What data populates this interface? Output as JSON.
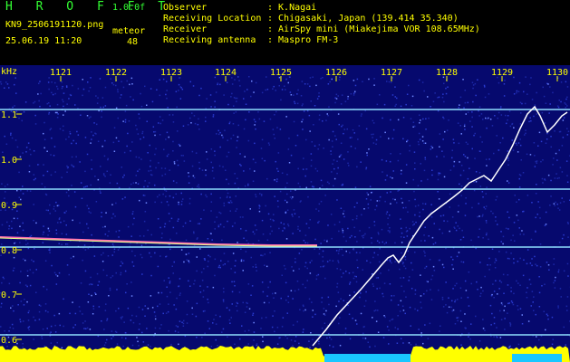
{
  "app": {
    "brand": "H R O F F T",
    "version": "1.0.0f"
  },
  "file": {
    "name": "KN9_2506191120.png",
    "timestamp": "25.06.19 11:20"
  },
  "meteor": {
    "label": "meteor",
    "count": "48"
  },
  "info": [
    {
      "key": "Observer",
      "value": ": K.Nagai"
    },
    {
      "key": "Receiving Location",
      "value": ": Chigasaki, Japan (139.414 35.340)"
    },
    {
      "key": "Receiver",
      "value": ": AirSpy mini (Miakejima VOR 108.65MHz)"
    },
    {
      "key": "Receiving antenna",
      "value": ": Maspro FM-3"
    }
  ],
  "spectrogram": {
    "y_unit": "kHz",
    "time_ticks": [
      "1121",
      "1122",
      "1123",
      "1124",
      "1125",
      "1126",
      "1127",
      "1128",
      "1129",
      "1130"
    ],
    "freq_ticks": [
      "1.1",
      "1.0",
      "0.9",
      "0.8",
      "0.7",
      "0.6"
    ],
    "colors": {
      "background": "#06096e",
      "noise": "#2a3bd0",
      "line": "#8fe0ff",
      "trace": "#ffffff",
      "floor": "#ffff00",
      "floor_alt": "#19c7ff"
    }
  }
}
